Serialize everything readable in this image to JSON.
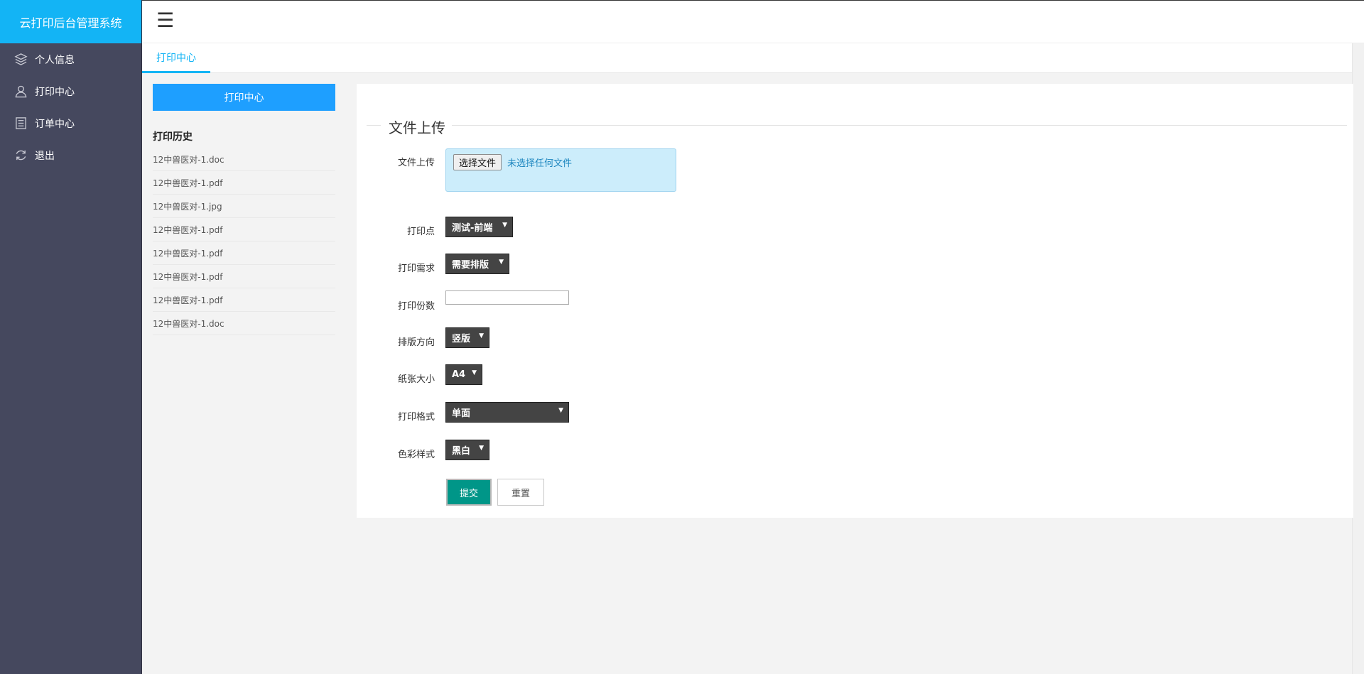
{
  "app": {
    "title": "云打印后台管理系统"
  },
  "sidebar": {
    "items": [
      {
        "label": "个人信息",
        "icon": "layers-icon"
      },
      {
        "label": "打印中心",
        "icon": "user-icon"
      },
      {
        "label": "订单中心",
        "icon": "list-icon"
      },
      {
        "label": "退出",
        "icon": "refresh-icon"
      }
    ]
  },
  "header": {
    "menu_icon": "hamburger-icon"
  },
  "tabs": [
    {
      "label": "打印中心",
      "active": true
    }
  ],
  "history": {
    "button_label": "打印中心",
    "title": "打印历史",
    "files": [
      "12中兽医对-1.doc",
      "12中兽医对-1.pdf",
      "12中兽医对-1.jpg",
      "12中兽医对-1.pdf",
      "12中兽医对-1.pdf",
      "12中兽医对-1.pdf",
      "12中兽医对-1.pdf",
      "12中兽医对-1.doc"
    ]
  },
  "form": {
    "legend": "文件上传",
    "upload": {
      "label": "文件上传",
      "button": "选择文件",
      "status": "未选择任何文件"
    },
    "print_point": {
      "label": "打印点",
      "value": "测试-前端"
    },
    "requirement": {
      "label": "打印需求",
      "value": "需要排版"
    },
    "copies": {
      "label": "打印份数",
      "value": ""
    },
    "orientation": {
      "label": "排版方向",
      "value": "竖版"
    },
    "paper_size": {
      "label": "纸张大小",
      "value": "A4"
    },
    "format": {
      "label": "打印格式",
      "value": "单面"
    },
    "color": {
      "label": "色彩样式",
      "value": "黑白"
    },
    "submit_label": "提交",
    "reset_label": "重置"
  },
  "colors": {
    "brand": "#13b4f5",
    "sidebar": "#45485e",
    "primary_button": "#1e9fff",
    "submit": "#009688"
  }
}
